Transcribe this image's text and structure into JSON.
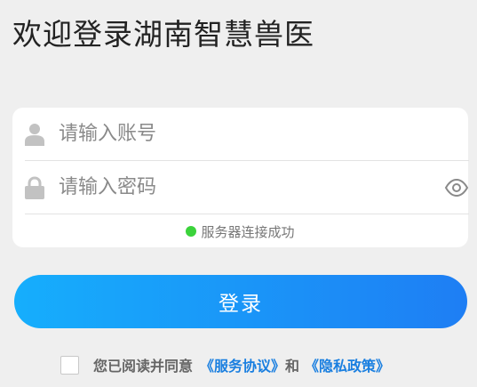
{
  "title": "欢迎登录湖南智慧兽医",
  "login_form": {
    "username_placeholder": "请输入账号",
    "password_placeholder": "请输入密码",
    "status_text": "服务器连接成功",
    "status_color": "#3bd33b",
    "username_icon": "user-icon",
    "password_icon": "lock-icon",
    "visibility_icon": "eye-icon"
  },
  "login_button": {
    "label": "登录",
    "gradient_start": "#16aefc",
    "gradient_end": "#1e7ef4"
  },
  "agreement": {
    "prefix": "您已阅读并同意",
    "service_link": "《服务协议》",
    "conjunction": "和",
    "privacy_link": "《隐私政策》",
    "checked": false
  }
}
